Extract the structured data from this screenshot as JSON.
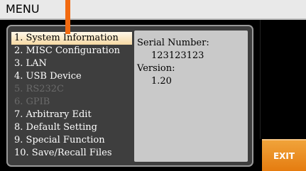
{
  "header": {
    "title": "MENU"
  },
  "menu": {
    "items": [
      {
        "label": "1. System Information"
      },
      {
        "label": "2. MISC Configuration"
      },
      {
        "label": "3. LAN"
      },
      {
        "label": "4. USB Device"
      },
      {
        "label": "5. RS232C"
      },
      {
        "label": "6. GPIB"
      },
      {
        "label": "7. Arbitrary Edit"
      },
      {
        "label": "8. Default Setting"
      },
      {
        "label": "9. Special Function"
      },
      {
        "label": "10. Save/Recall Files"
      }
    ]
  },
  "info": {
    "serial_label": "Serial Number:",
    "serial_value": "123123123",
    "version_label": "Version:",
    "version_value": "1.20"
  },
  "softkeys": {
    "exit_label": "EXIT"
  },
  "colors": {
    "accent": "#f26a10",
    "selected_bg": "#f6d9a3",
    "panel_bg": "#3e3e3e",
    "info_bg": "#c9c9c9",
    "exit_bg": "#e57c10"
  }
}
